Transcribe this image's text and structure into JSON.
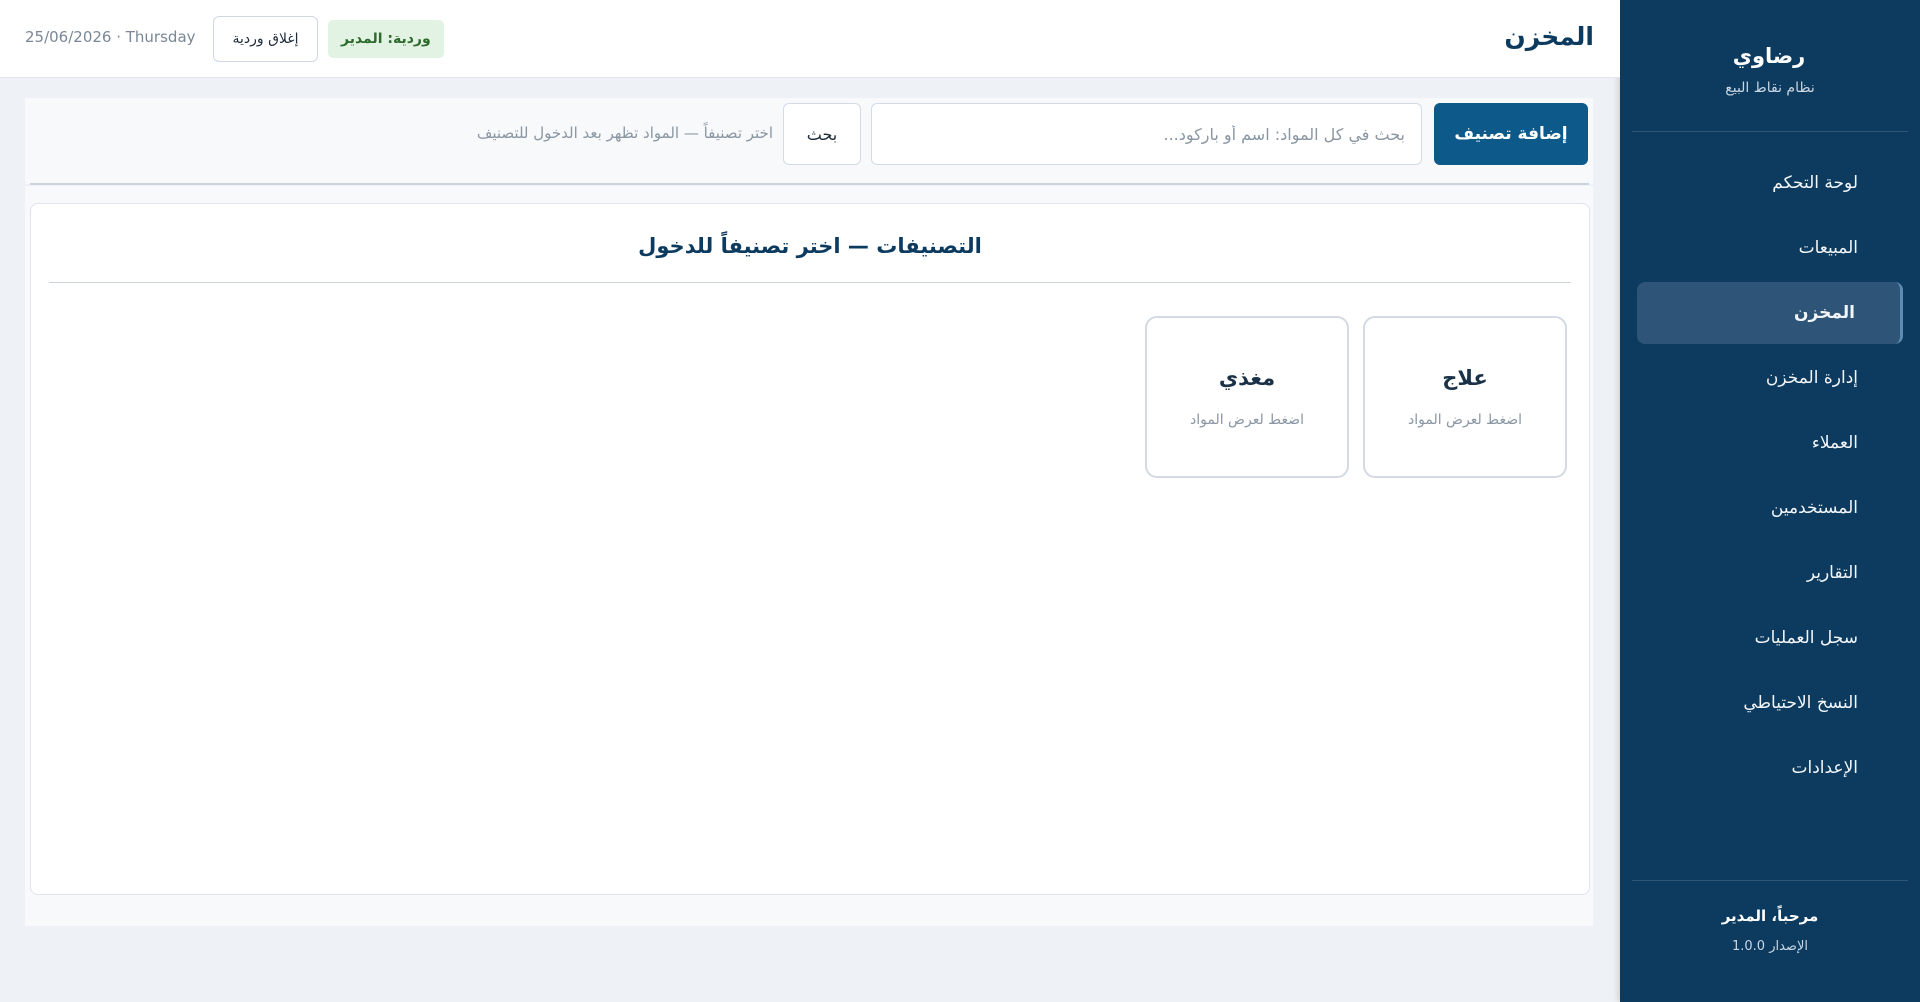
{
  "sidebar": {
    "brand_name": "رضاوي",
    "brand_subtitle": "نظام نقاط البيع",
    "items": [
      {
        "label": "لوحة التحكم"
      },
      {
        "label": "المبيعات"
      },
      {
        "label": "المخزن"
      },
      {
        "label": "إدارة المخزن"
      },
      {
        "label": "العملاء"
      },
      {
        "label": "المستخدمين"
      },
      {
        "label": "التقارير"
      },
      {
        "label": "سجل العمليات"
      },
      {
        "label": "النسخ الاحتياطي"
      },
      {
        "label": "الإعدادات"
      }
    ],
    "active_index": 2,
    "welcome": "مرحباً، المدير",
    "version": "الإصدار 1.0.0"
  },
  "header": {
    "title": "المخزن",
    "shift_badge": "وردية: المدير",
    "close_shift_label": "إغلاق وردية",
    "datetime": "25/06/2026 · Thursday"
  },
  "toolbar": {
    "add_category_label": "إضافة تصنيف",
    "search_placeholder": "بحث في كل المواد: اسم أو باركود...",
    "search_value": "",
    "search_button_label": "بحث",
    "hint": "اختر تصنيفاً — المواد تظهر بعد الدخول للتصنيف"
  },
  "categories_panel": {
    "title": "التصنيفات — اختر تصنيفاً للدخول",
    "cards": [
      {
        "name": "علاج",
        "hint": "اضغط لعرض المواد"
      },
      {
        "name": "مغذي",
        "hint": "اضغط لعرض المواد"
      }
    ]
  },
  "colors": {
    "sidebar_bg": "#0d3b5f",
    "sidebar_active": "#2e5578",
    "primary_button": "#0d5a8a",
    "shift_badge_bg": "#e3f3e3",
    "shift_badge_text": "#2d6b2d"
  }
}
